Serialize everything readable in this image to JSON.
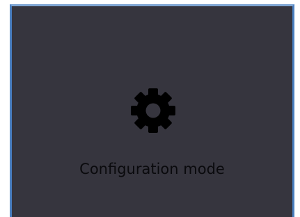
{
  "panel": {
    "mode_label": "Configuration mode",
    "icon": "gear-icon"
  },
  "colors": {
    "background": "#36353e",
    "border": "#4a7fc0",
    "icon": "#000000",
    "text": "#0a0a0d"
  }
}
